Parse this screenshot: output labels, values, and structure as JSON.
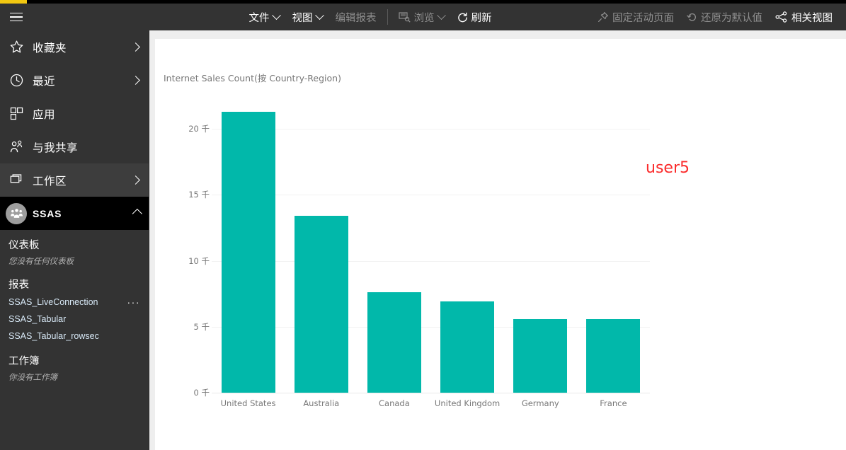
{
  "theme": {
    "accent_yellow": "#f2c811",
    "chrome_dark": "#333333",
    "bar_teal": "#01b8aa",
    "annotation_red": "#fb2c2c",
    "link_blue": "#d8e9f7"
  },
  "topbar": {
    "menu_icon": "hamburger-icon",
    "items": [
      {
        "label": "文件",
        "icon": "",
        "caret": true,
        "dim": false,
        "name": "file-menu"
      },
      {
        "label": "视图",
        "icon": "",
        "caret": true,
        "dim": false,
        "name": "view-menu"
      },
      {
        "label": "编辑报表",
        "icon": "",
        "caret": false,
        "dim": true,
        "name": "edit-report-button"
      }
    ],
    "items2": [
      {
        "label": "浏览",
        "icon": "explore-icon",
        "caret": true,
        "dim": true,
        "name": "explore-menu"
      },
      {
        "label": "刷新",
        "icon": "refresh-icon",
        "caret": false,
        "dim": false,
        "name": "refresh-button"
      }
    ],
    "items_right": [
      {
        "label": "固定活动页面",
        "icon": "pin-icon",
        "caret": false,
        "dim": true,
        "name": "pin-active-page-button"
      },
      {
        "label": "还原为默认值",
        "icon": "reset-icon",
        "caret": false,
        "dim": true,
        "name": "reset-to-default-button"
      },
      {
        "label": "相关视图",
        "icon": "related-icon",
        "caret": false,
        "dim": false,
        "name": "related-views-button"
      }
    ]
  },
  "sidebar": {
    "nav": [
      {
        "label": "收藏夹",
        "icon": "star-icon",
        "chevron": "right",
        "state": "normal",
        "name": "sidebar-item-favorites"
      },
      {
        "label": "最近",
        "icon": "clock-icon",
        "chevron": "right",
        "state": "normal",
        "name": "sidebar-item-recent"
      },
      {
        "label": "应用",
        "icon": "apps-icon",
        "chevron": "none",
        "state": "normal",
        "name": "sidebar-item-apps"
      },
      {
        "label": "与我共享",
        "icon": "shared-icon",
        "chevron": "none",
        "state": "normal",
        "name": "sidebar-item-shared-with-me"
      },
      {
        "label": "工作区",
        "icon": "workspace-icon",
        "chevron": "right",
        "state": "hover",
        "name": "sidebar-item-workspaces"
      }
    ],
    "workspace": {
      "label": "SSAS",
      "icon": "group-avatar-icon",
      "chevron": "up",
      "name": "sidebar-workspace-ssas"
    },
    "groups": [
      {
        "title": "仪表板",
        "empty_text": "您没有任何仪表板",
        "items": [],
        "name": "dashboards-group"
      },
      {
        "title": "报表",
        "empty_text": "",
        "items": [
          {
            "label": "SSAS_LiveConnection",
            "more": "···",
            "name": "report-ssas-liveconnection"
          },
          {
            "label": "SSAS_Tabular",
            "more": "",
            "name": "report-ssas-tabular"
          },
          {
            "label": "SSAS_Tabular_rowsec",
            "more": "",
            "name": "report-ssas-tabular-rowsec"
          }
        ],
        "name": "reports-group"
      },
      {
        "title": "工作簿",
        "empty_text": "你没有工作簿",
        "items": [],
        "name": "workbooks-group"
      }
    ]
  },
  "report": {
    "annotation": "user5"
  },
  "chart_data": {
    "type": "bar",
    "title": "Internet Sales Count(按 Country-Region)",
    "xlabel": "",
    "ylabel": "",
    "categories": [
      "United States",
      "Australia",
      "Canada",
      "United Kingdom",
      "Germany",
      "France"
    ],
    "values": [
      21300,
      13400,
      7600,
      6900,
      5600,
      5600
    ],
    "ylim": [
      0,
      21300
    ],
    "yticks": [
      0,
      5000,
      10000,
      15000,
      20000
    ],
    "ytick_labels": [
      "0 千",
      "5 千",
      "10 千",
      "15 千",
      "20 千"
    ],
    "grid": true,
    "legend": "none",
    "series": [
      {
        "name": "Internet Sales Count",
        "color": "#01b8aa",
        "values": [
          21300,
          13400,
          7600,
          6900,
          5600,
          5600
        ]
      }
    ]
  }
}
